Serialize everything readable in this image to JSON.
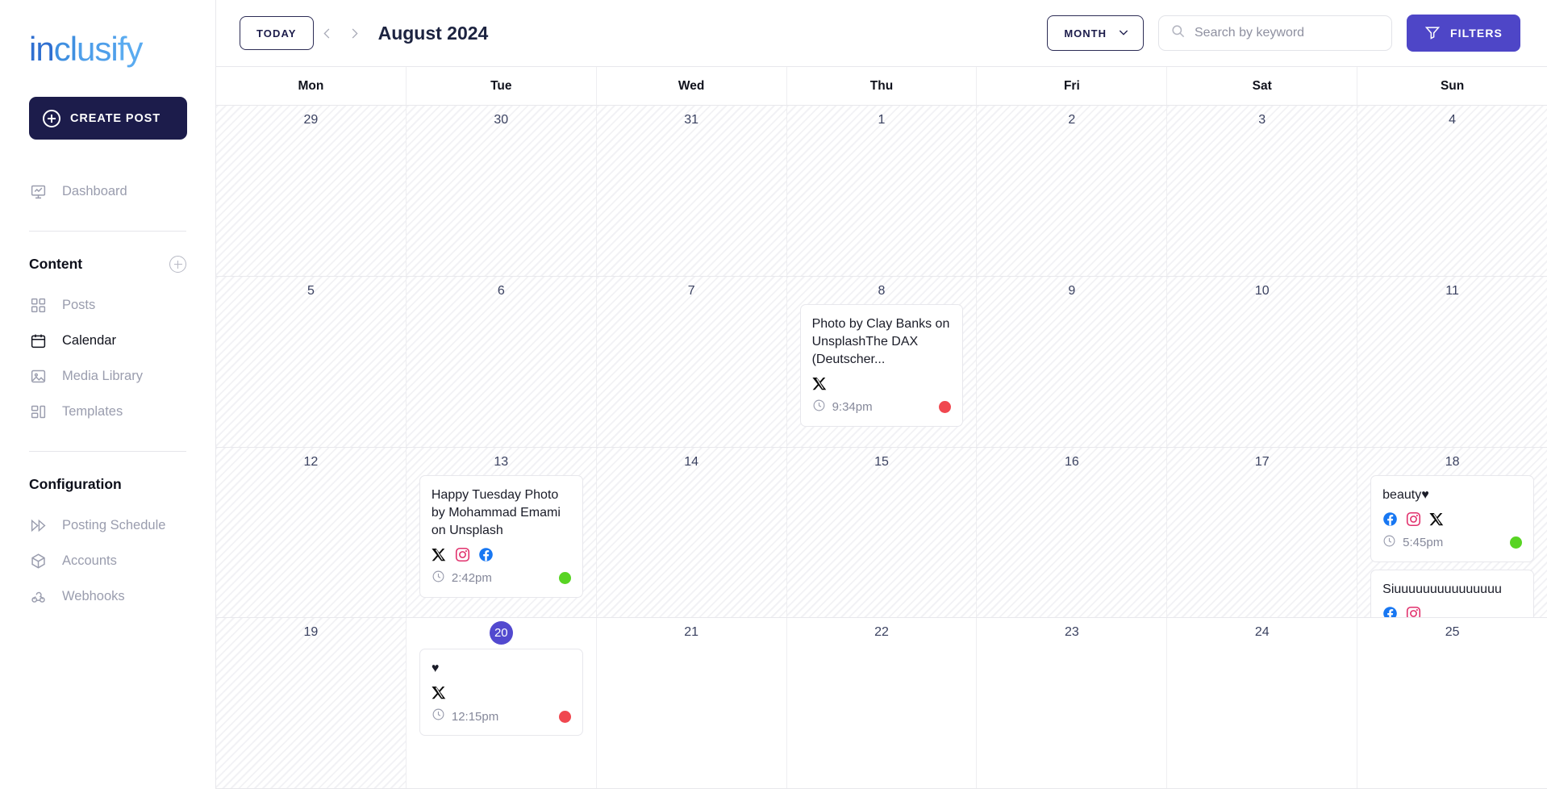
{
  "brand": {
    "logo_text": "inclusify"
  },
  "sidebar": {
    "create_post_label": "CREATE POST",
    "primary": [
      {
        "label": "Dashboard",
        "icon": "dashboard-icon",
        "active": false
      }
    ],
    "content_section": {
      "title": "Content",
      "add_icon": "plus-circle-icon"
    },
    "content_items": [
      {
        "label": "Posts",
        "icon": "grid-icon",
        "active": false
      },
      {
        "label": "Calendar",
        "icon": "calendar-icon",
        "active": true
      },
      {
        "label": "Media Library",
        "icon": "image-icon",
        "active": false
      },
      {
        "label": "Templates",
        "icon": "templates-icon",
        "active": false
      }
    ],
    "configuration_section": {
      "title": "Configuration"
    },
    "configuration_items": [
      {
        "label": "Posting Schedule",
        "icon": "fast-forward-icon",
        "active": false
      },
      {
        "label": "Accounts",
        "icon": "box-icon",
        "active": false
      },
      {
        "label": "Webhooks",
        "icon": "webhook-icon",
        "active": false
      }
    ]
  },
  "toolbar": {
    "today_label": "TODAY",
    "prev_icon": "chevron-left-icon",
    "next_icon": "chevron-right-icon",
    "month_title": "August 2024",
    "view_selected": "MONTH",
    "view_chevron_icon": "chevron-down-icon",
    "search_placeholder": "Search by keyword",
    "search_value": "",
    "search_icon": "search-icon",
    "filters_label": "FILTERS",
    "filters_icon": "funnel-icon"
  },
  "colors": {
    "accent": "#4e46c7",
    "today_badge": "#5249cf",
    "status_green": "#58d423",
    "status_red": "#f0474f",
    "sidebar_active": "#10121c",
    "create_post_bg": "#1c1c4b"
  },
  "calendar": {
    "weekdays": [
      "Mon",
      "Tue",
      "Wed",
      "Thu",
      "Fri",
      "Sat",
      "Sun"
    ],
    "weeks": [
      [
        {
          "num": "29",
          "past": true,
          "today": false,
          "events": []
        },
        {
          "num": "30",
          "past": true,
          "today": false,
          "events": []
        },
        {
          "num": "31",
          "past": true,
          "today": false,
          "events": []
        },
        {
          "num": "1",
          "past": true,
          "today": false,
          "events": []
        },
        {
          "num": "2",
          "past": true,
          "today": false,
          "events": []
        },
        {
          "num": "3",
          "past": true,
          "today": false,
          "events": []
        },
        {
          "num": "4",
          "past": true,
          "today": false,
          "events": []
        }
      ],
      [
        {
          "num": "5",
          "past": true,
          "today": false,
          "events": []
        },
        {
          "num": "6",
          "past": true,
          "today": false,
          "events": []
        },
        {
          "num": "7",
          "past": true,
          "today": false,
          "events": []
        },
        {
          "num": "8",
          "past": true,
          "today": false,
          "events": [
            {
              "title": "Photo by Clay Banks on UnsplashThe DAX (Deutscher...",
              "channels": [
                "x"
              ],
              "time": "9:34pm",
              "status": "red"
            }
          ]
        },
        {
          "num": "9",
          "past": true,
          "today": false,
          "events": []
        },
        {
          "num": "10",
          "past": true,
          "today": false,
          "events": []
        },
        {
          "num": "11",
          "past": true,
          "today": false,
          "events": []
        }
      ],
      [
        {
          "num": "12",
          "past": true,
          "today": false,
          "events": []
        },
        {
          "num": "13",
          "past": true,
          "today": false,
          "events": [
            {
              "title": "Happy Tuesday Photo by Mohammad Emami on Unsplash",
              "channels": [
                "x",
                "instagram",
                "facebook"
              ],
              "time": "2:42pm",
              "status": "green"
            }
          ]
        },
        {
          "num": "14",
          "past": true,
          "today": false,
          "events": []
        },
        {
          "num": "15",
          "past": true,
          "today": false,
          "events": []
        },
        {
          "num": "16",
          "past": true,
          "today": false,
          "events": []
        },
        {
          "num": "17",
          "past": true,
          "today": false,
          "events": []
        },
        {
          "num": "18",
          "past": true,
          "today": false,
          "events": [
            {
              "title": "beauty♥",
              "channels": [
                "facebook",
                "instagram",
                "x"
              ],
              "time": "5:45pm",
              "status": "green"
            },
            {
              "title": "Siuuuuuuuuuuuuuuu",
              "channels": [
                "facebook",
                "instagram"
              ],
              "time": "",
              "status": ""
            }
          ]
        }
      ],
      [
        {
          "num": "19",
          "past": true,
          "today": false,
          "events": []
        },
        {
          "num": "20",
          "past": false,
          "today": true,
          "events": [
            {
              "title": "♥",
              "channels": [
                "x"
              ],
              "time": "12:15pm",
              "status": "red"
            }
          ]
        },
        {
          "num": "21",
          "past": false,
          "today": false,
          "events": []
        },
        {
          "num": "22",
          "past": false,
          "today": false,
          "events": []
        },
        {
          "num": "23",
          "past": false,
          "today": false,
          "events": []
        },
        {
          "num": "24",
          "past": false,
          "today": false,
          "events": []
        },
        {
          "num": "25",
          "past": false,
          "today": false,
          "events": []
        }
      ]
    ]
  }
}
